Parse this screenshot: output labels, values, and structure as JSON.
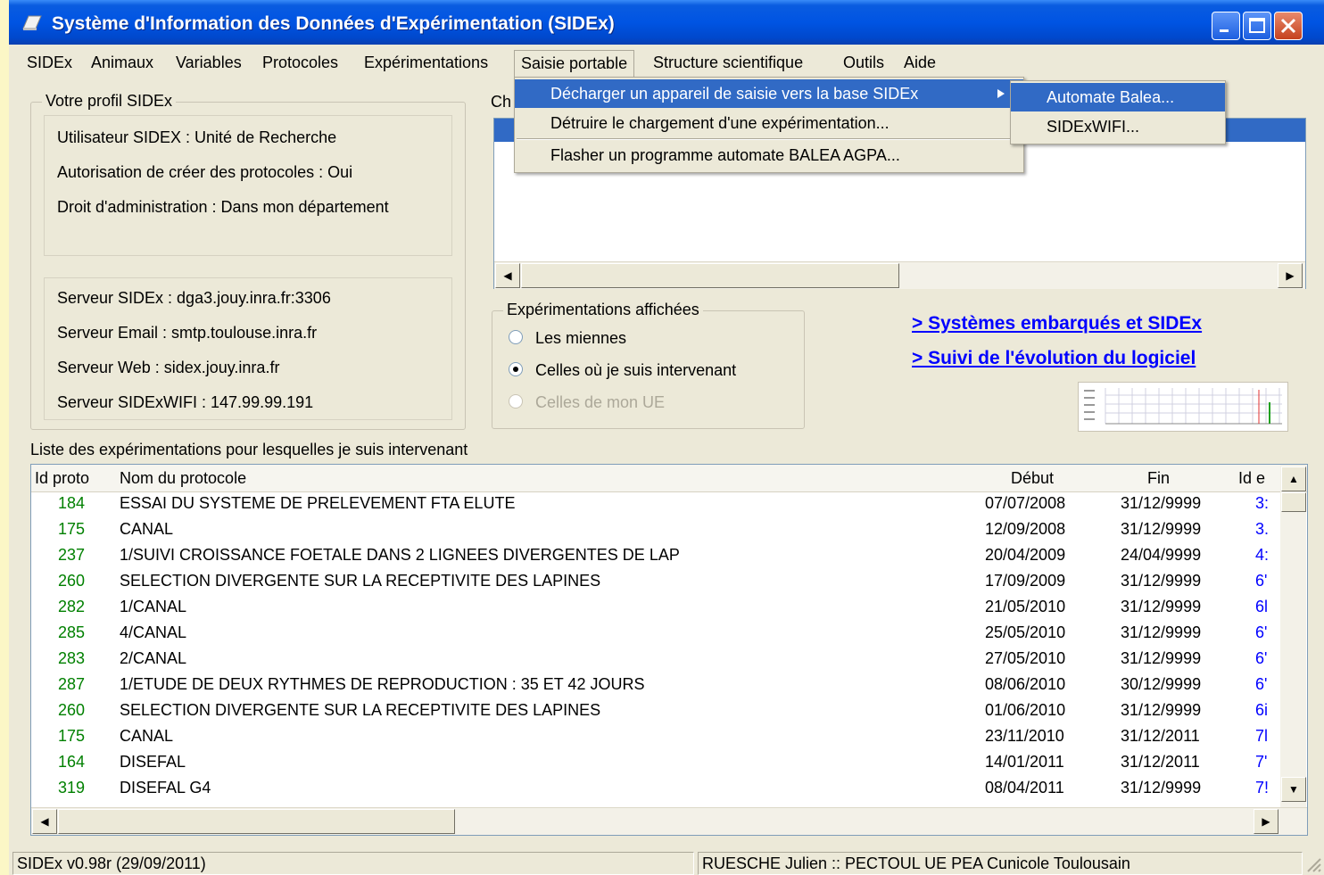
{
  "window": {
    "title": "Système d'Information des Données d'Expérimentation (SIDEx)"
  },
  "menubar": {
    "items": [
      "SIDEx",
      "Animaux",
      "Variables",
      "Protocoles",
      "Expérimentations",
      "Saisie portable",
      "Structure scientifique",
      "Outils",
      "Aide"
    ],
    "active": "Saisie portable"
  },
  "dropdown": {
    "items": [
      "Décharger un appareil de saisie vers la base SIDEx",
      "Détruire le chargement d'une expérimentation...",
      "Flasher un programme automate BALEA AGPA..."
    ],
    "submenu": [
      "Automate Balea...",
      "SIDExWIFI..."
    ]
  },
  "profile": {
    "title": "Votre profil SIDEx",
    "user": "Utilisateur SIDEX : Unité de Recherche",
    "create_protocols": "Autorisation de créer des protocoles : Oui",
    "admin": "Droit d'administration : Dans mon département",
    "server_sidex": "Serveur SIDEx : dga3.jouy.inra.fr:3306",
    "server_email": "Serveur Email : smtp.toulouse.inra.fr",
    "server_web": "Serveur Web : sidex.jouy.inra.fr",
    "server_wifi": "Serveur SIDExWIFI : 147.99.99.191"
  },
  "load_box": {
    "label_partial": "Ch"
  },
  "filter": {
    "title": "Expérimentations affichées",
    "options": [
      "Les miennes",
      "Celles où je suis intervenant",
      "Celles de mon UE"
    ],
    "selected_index": 1,
    "disabled_index": 2
  },
  "links": {
    "embedded": "> Systèmes embarqués et SIDEx",
    "evolution": "> Suivi de l'évolution du logiciel "
  },
  "list": {
    "caption": "Liste des expérimentations pour lesquelles je suis intervenant",
    "headers": [
      "Id proto",
      "Nom du protocole",
      "Début",
      "Fin",
      "Id e"
    ],
    "rows": [
      {
        "id": "184",
        "name": "ESSAI DU SYSTEME DE PRELEVEMENT FTA ELUTE",
        "debut": "07/07/2008",
        "fin": "31/12/9999",
        "ide": "3:"
      },
      {
        "id": "175",
        "name": "CANAL",
        "debut": "12/09/2008",
        "fin": "31/12/9999",
        "ide": "3."
      },
      {
        "id": "237",
        "name": "1/SUIVI CROISSANCE FOETALE DANS 2 LIGNEES DIVERGENTES DE LAP",
        "debut": "20/04/2009",
        "fin": "24/04/9999",
        "ide": "4:"
      },
      {
        "id": "260",
        "name": "SELECTION DIVERGENTE SUR LA RECEPTIVITE DES LAPINES",
        "debut": "17/09/2009",
        "fin": "31/12/9999",
        "ide": "6'"
      },
      {
        "id": "282",
        "name": "1/CANAL",
        "debut": "21/05/2010",
        "fin": "31/12/9999",
        "ide": "6l"
      },
      {
        "id": "285",
        "name": "4/CANAL",
        "debut": "25/05/2010",
        "fin": "31/12/9999",
        "ide": "6'"
      },
      {
        "id": "283",
        "name": "2/CANAL",
        "debut": "27/05/2010",
        "fin": "31/12/9999",
        "ide": "6'"
      },
      {
        "id": "287",
        "name": "1/ETUDE DE DEUX RYTHMES DE REPRODUCTION : 35 ET 42 JOURS",
        "debut": "08/06/2010",
        "fin": "30/12/9999",
        "ide": "6'"
      },
      {
        "id": "260",
        "name": "SELECTION DIVERGENTE SUR LA RECEPTIVITE DES LAPINES",
        "debut": "01/06/2010",
        "fin": "31/12/9999",
        "ide": "6i"
      },
      {
        "id": "175",
        "name": "CANAL",
        "debut": "23/11/2010",
        "fin": "31/12/2011",
        "ide": "7l"
      },
      {
        "id": "164",
        "name": "DISEFAL",
        "debut": "14/01/2011",
        "fin": "31/12/2011",
        "ide": "7'"
      },
      {
        "id": "319",
        "name": "DISEFAL G4",
        "debut": "08/04/2011",
        "fin": "31/12/9999",
        "ide": "7!"
      }
    ]
  },
  "status": {
    "version": "SIDEx v0.98r (29/09/2011)",
    "user": "RUESCHE Julien  :: PECTOUL UE PEA Cunicole Toulousain"
  },
  "colors": {
    "titlebar": "#0054e3",
    "selection": "#316ac5",
    "link": "#0000ff",
    "id_text": "#008000",
    "face": "#ece9d8"
  }
}
